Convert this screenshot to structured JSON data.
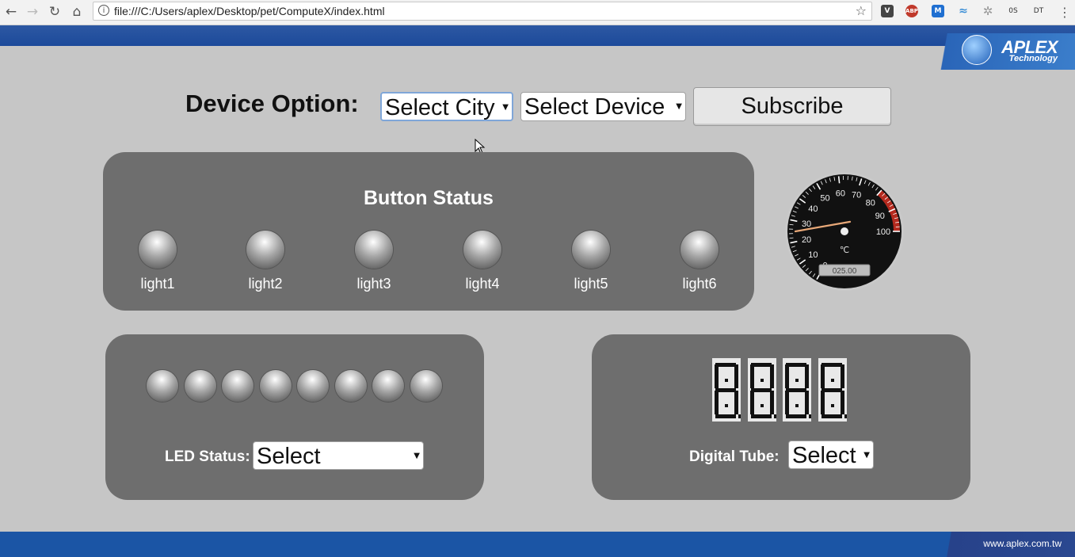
{
  "browser": {
    "url": "file:///C:/Users/aplex/Desktop/pet/ComputeX/index.html",
    "extensions": [
      {
        "name": "v-icon",
        "text": "V",
        "color": "#444444"
      },
      {
        "name": "adblock-icon",
        "text": "ABP",
        "color": "#c0392b"
      },
      {
        "name": "m-icon",
        "text": "M",
        "color": "#1f6fd1"
      },
      {
        "name": "bird-icon",
        "text": "",
        "color": "#3d8fd6"
      },
      {
        "name": "loading-icon",
        "text": "",
        "color": "#999999"
      },
      {
        "name": "os-icon",
        "text": "0S",
        "color": "#ffffff"
      },
      {
        "name": "dt-icon",
        "text": "DT",
        "color": "#ffffff"
      }
    ]
  },
  "brand": {
    "logo": "APLEX",
    "logo_sub": "Technology",
    "website": "www.aplex.com.tw",
    "primary_color": "#1b55a5"
  },
  "device_option": {
    "label": "Device Option:",
    "city_select": "Select City",
    "device_select": "Select Device",
    "subscribe_label": "Subscribe"
  },
  "button_status": {
    "title": "Button Status",
    "lights": [
      "light1",
      "light2",
      "light3",
      "light4",
      "light5",
      "light6"
    ]
  },
  "gauge": {
    "unit": "℃",
    "readout": "025.00",
    "value": 25,
    "min": 0,
    "max": 100,
    "ticks": [
      "0",
      "10",
      "20",
      "30",
      "40",
      "50",
      "60",
      "70",
      "80",
      "90",
      "100"
    ],
    "danger_from": 80,
    "needle_color": "#e8a878",
    "danger_color": "#b52a1f"
  },
  "led_status": {
    "label": "LED Status:",
    "select": "Select",
    "led_count": 8
  },
  "digital_tube": {
    "label": "Digital Tube:",
    "select": "Select",
    "digits": [
      "8",
      "8",
      "8",
      "8"
    ]
  }
}
